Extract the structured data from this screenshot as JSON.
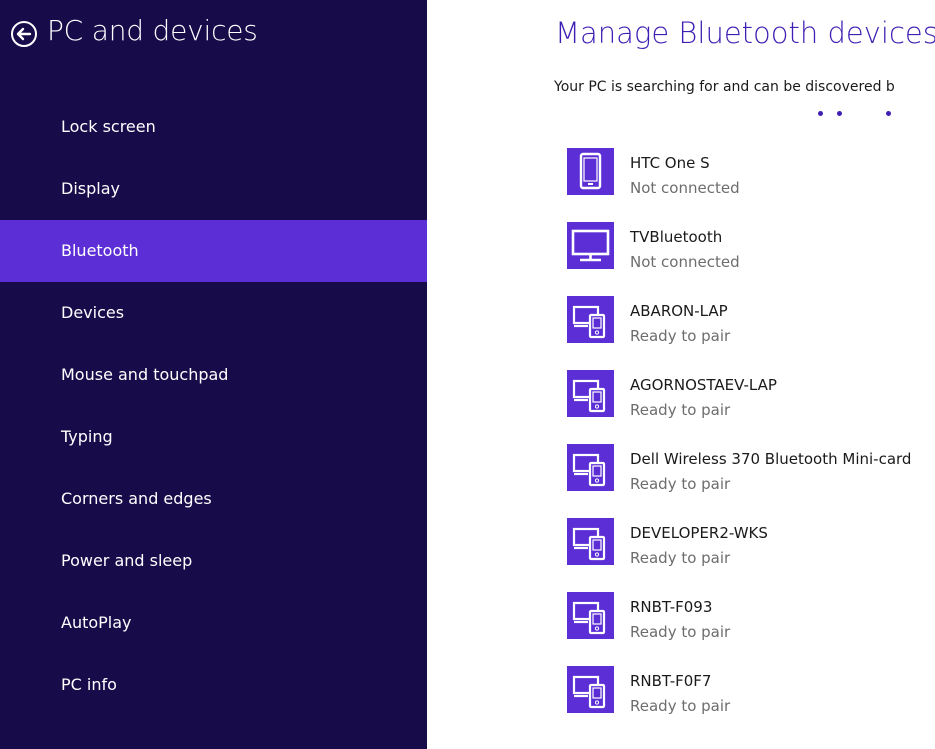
{
  "sidebar": {
    "title": "PC and devices",
    "back_icon": "back-arrow-circle-icon",
    "search_icon": "search-icon",
    "items": [
      {
        "label": "Lock screen",
        "selected": false
      },
      {
        "label": "Display",
        "selected": false
      },
      {
        "label": "Bluetooth",
        "selected": true
      },
      {
        "label": "Devices",
        "selected": false
      },
      {
        "label": "Mouse and touchpad",
        "selected": false
      },
      {
        "label": "Typing",
        "selected": false
      },
      {
        "label": "Corners and edges",
        "selected": false
      },
      {
        "label": "Power and sleep",
        "selected": false
      },
      {
        "label": "AutoPlay",
        "selected": false
      },
      {
        "label": "PC info",
        "selected": false
      }
    ]
  },
  "main": {
    "title": "Manage Bluetooth devices",
    "status_text": "Your PC is searching for and can be discovered b",
    "devices": [
      {
        "name": "HTC One S",
        "status": "Not connected",
        "icon": "phone-icon"
      },
      {
        "name": "TVBluetooth",
        "status": "Not connected",
        "icon": "monitor-icon"
      },
      {
        "name": "ABARON-LAP",
        "status": "Ready to pair",
        "icon": "computer-devices-icon"
      },
      {
        "name": "AGORNOSTAEV-LAP",
        "status": "Ready to pair",
        "icon": "computer-devices-icon"
      },
      {
        "name": "Dell Wireless 370 Bluetooth Mini-card",
        "status": "Ready to pair",
        "icon": "computer-devices-icon"
      },
      {
        "name": "DEVELOPER2-WKS",
        "status": "Ready to pair",
        "icon": "computer-devices-icon"
      },
      {
        "name": "RNBT-F093",
        "status": "Ready to pair",
        "icon": "computer-devices-icon"
      },
      {
        "name": "RNBT-F0F7",
        "status": "Ready to pair",
        "icon": "computer-devices-icon"
      }
    ]
  },
  "colors": {
    "sidebar_bg": "#180b4a",
    "accent": "#5c2fd6",
    "title_color": "#3f1fb3",
    "secondary_text": "#6d6d6d"
  }
}
